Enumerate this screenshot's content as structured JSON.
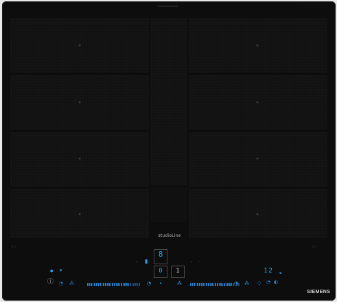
{
  "product": {
    "series_label": "studioLine",
    "brand": "SIEMENS"
  },
  "display": {
    "zone_left_level": "8",
    "zone_center_a": "0",
    "zone_center_b": "1",
    "timer": "12"
  },
  "colors": {
    "glass": "#0d0d0d",
    "accent_blue": "#2aa6e8"
  },
  "icons": {
    "power": "power-icon",
    "wipe_protect": "fan-icon",
    "menu": "menu-icon"
  }
}
